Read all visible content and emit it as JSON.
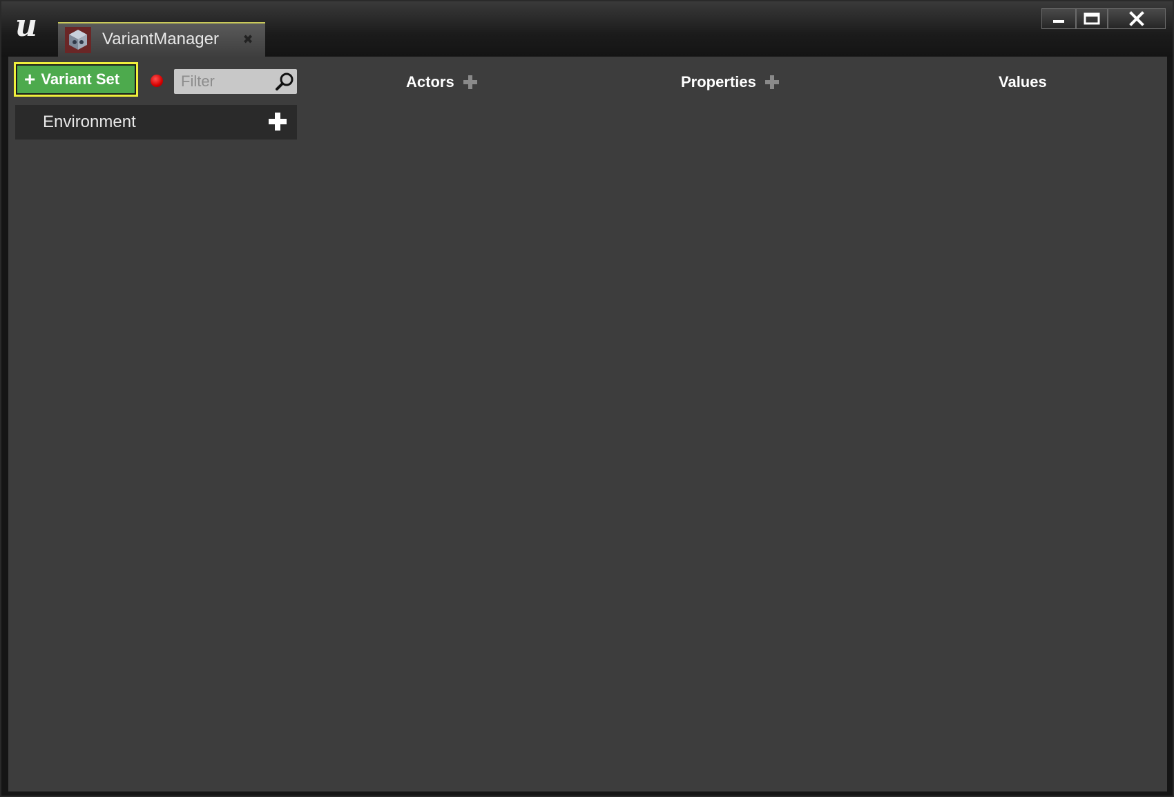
{
  "window": {
    "tab_title": "VariantManager",
    "tab_icon": "variant-manager-icon",
    "close_tab_glyph": "✖",
    "controls": [
      "minimize-icon",
      "maximize-icon",
      "close-icon"
    ]
  },
  "toolbar": {
    "add_variant_set_label": "Variant Set",
    "add_variant_set_glyph": "+",
    "filter_placeholder": "Filter"
  },
  "columns": {
    "actors": "Actors",
    "properties": "Properties",
    "values": "Values"
  },
  "variant_sets": [
    {
      "label": "Environment"
    }
  ],
  "colors": {
    "accent_green": "#4daa4d",
    "focus_yellow": "#f0f03c",
    "record_red": "#d40000",
    "panel_bg": "#3d3d3d",
    "row_bg": "#2a2a2a"
  }
}
